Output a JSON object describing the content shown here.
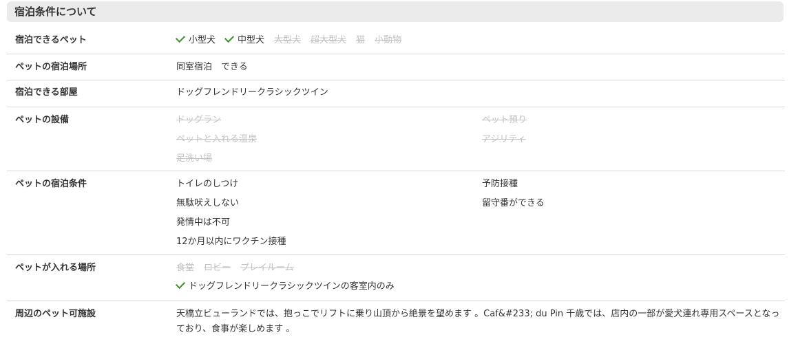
{
  "section": {
    "title": "宿泊条件について"
  },
  "rows": {
    "pets": {
      "label": "宿泊できるペット",
      "items": [
        {
          "text": "小型犬",
          "available": true
        },
        {
          "text": "中型犬",
          "available": true
        },
        {
          "text": "大型犬",
          "available": false
        },
        {
          "text": "超大型犬",
          "available": false
        },
        {
          "text": "猫",
          "available": false
        },
        {
          "text": "小動物",
          "available": false
        }
      ]
    },
    "location": {
      "label": "ペットの宿泊場所",
      "value": "同室宿泊　できる"
    },
    "rooms": {
      "label": "宿泊できる部屋",
      "value": "ドッグフレンドリークラシックツイン"
    },
    "facilities": {
      "label": "ペットの設備",
      "left": [
        "ドッグラン",
        "ペットと入れる温泉",
        "足洗い場"
      ],
      "right": [
        "ペット預り",
        "アジリティ"
      ]
    },
    "conditions": {
      "label": "ペットの宿泊条件",
      "left": [
        "トイレのしつけ",
        "無駄吠えしない",
        "発情中は不可",
        "12か月以内にワクチン接種"
      ],
      "right": [
        "予防接種",
        "留守番ができる"
      ]
    },
    "places": {
      "label": "ペットが入れる場所",
      "disabled": [
        "食堂",
        "ロビー",
        "プレイルーム"
      ],
      "enabled": "ドッグフレンドリークラシックツインの客室内のみ"
    },
    "nearby": {
      "label": "周辺のペット可施設",
      "text": "天橋立ビューランドでは、抱っこでリフトに乗り山頂から絶景を望めます 。Caf&#233; du Pin 千歳では、店内の一部が愛犬連れ専用スペースとなっており、食事が楽しめます 。"
    }
  }
}
